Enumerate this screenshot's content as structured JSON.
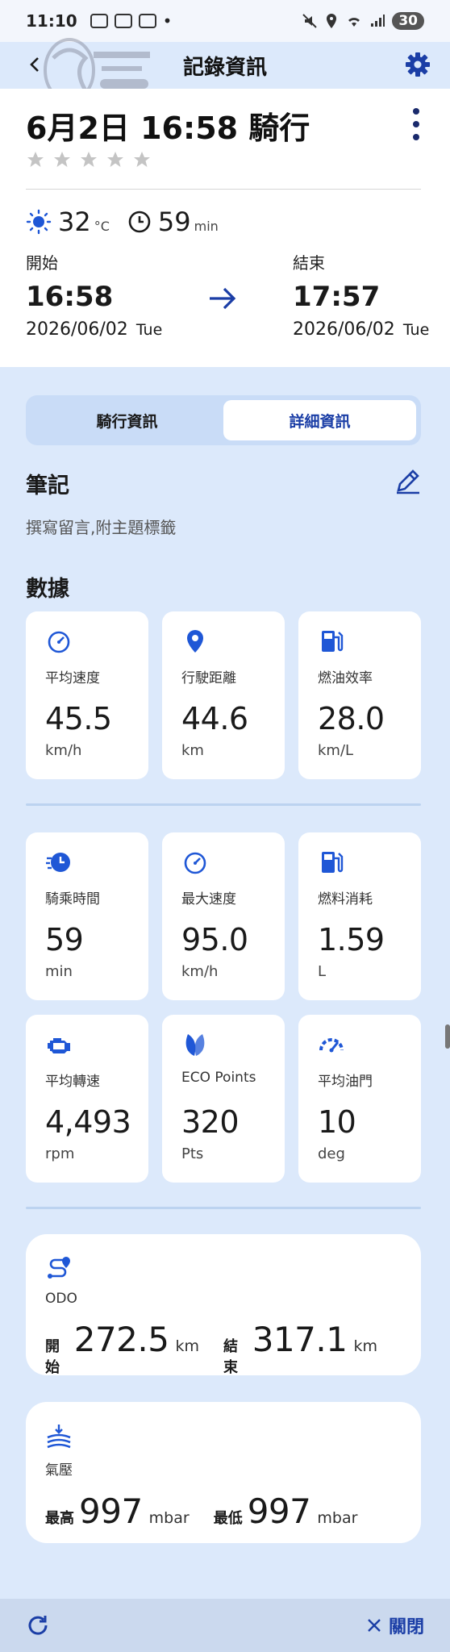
{
  "status_bar": {
    "time": "11:10",
    "battery": "30"
  },
  "app_bar": {
    "title": "記錄資訊"
  },
  "ride": {
    "title": "6月2日 16:58 騎行",
    "rating": 0,
    "temperature": "32",
    "temperature_unit": "°C",
    "duration": "59",
    "duration_unit": "min",
    "start_label": "開始",
    "end_label": "結束",
    "start_time": "16:58",
    "end_time": "17:57",
    "start_date": "2026/06/02",
    "start_dow": "Tue",
    "end_date": "2026/06/02",
    "end_dow": "Tue"
  },
  "tabs": [
    {
      "label": "騎行資訊",
      "active": false
    },
    {
      "label": "詳細資訊",
      "active": true
    }
  ],
  "notes": {
    "heading": "筆記",
    "placeholder": "撰寫留言,附主題標籤"
  },
  "data_heading": "數據",
  "stats": [
    {
      "icon": "speedometer-icon",
      "label": "平均速度",
      "value": "45.5",
      "unit": "km/h"
    },
    {
      "icon": "location-pin-icon",
      "label": "行駛距離",
      "value": "44.6",
      "unit": "km"
    },
    {
      "icon": "fuel-pump-icon",
      "label": "燃油效率",
      "value": "28.0",
      "unit": "km/L"
    },
    {
      "icon": "timer-icon",
      "label": "騎乘時間",
      "value": "59",
      "unit": "min"
    },
    {
      "icon": "speedometer-icon",
      "label": "最大速度",
      "value": "95.0",
      "unit": "km/h"
    },
    {
      "icon": "fuel-pump-icon",
      "label": "燃料消耗",
      "value": "1.59",
      "unit": "L"
    },
    {
      "icon": "engine-icon",
      "label": "平均轉速",
      "value": "4,493",
      "unit": "rpm"
    },
    {
      "icon": "leaf-icon",
      "label": "ECO Points",
      "value": "320",
      "unit": "Pts"
    },
    {
      "icon": "throttle-gauge-icon",
      "label": "平均油門",
      "value": "10",
      "unit": "deg"
    }
  ],
  "odo": {
    "label": "ODO",
    "start_key": "開始",
    "start_value": "272.5",
    "start_unit": "km",
    "end_key": "結束",
    "end_value": "317.1",
    "end_unit": "km"
  },
  "pressure": {
    "label": "氣壓",
    "max_key": "最高",
    "max_value": "997",
    "max_unit": "mbar",
    "min_key": "最低",
    "min_value": "997",
    "min_unit": "mbar"
  },
  "bottom": {
    "close_label": "關閉"
  },
  "colors": {
    "accent": "#1b3ea6",
    "icon_blue": "#1f57d6",
    "background": "#dce9fb"
  }
}
